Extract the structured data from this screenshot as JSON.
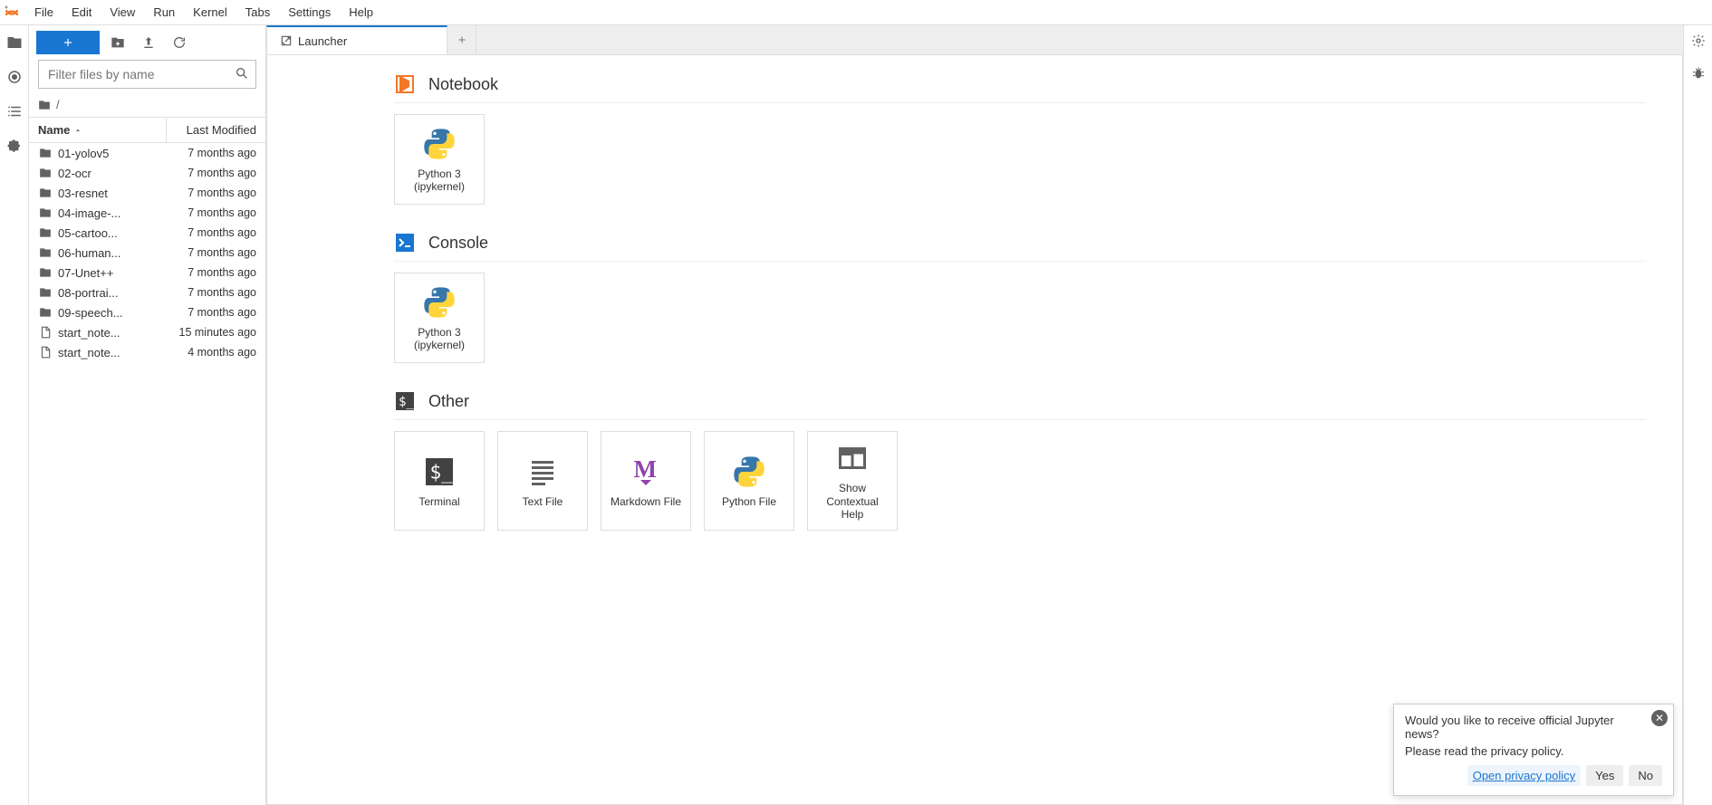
{
  "menu": {
    "items": [
      "File",
      "Edit",
      "View",
      "Run",
      "Kernel",
      "Tabs",
      "Settings",
      "Help"
    ]
  },
  "filebrowser": {
    "filter_placeholder": "Filter files by name",
    "breadcrumb_root": "/",
    "columns": {
      "name": "Name",
      "modified": "Last Modified"
    },
    "files": [
      {
        "type": "folder",
        "name": "01-yolov5",
        "modified": "7 months ago"
      },
      {
        "type": "folder",
        "name": "02-ocr",
        "modified": "7 months ago"
      },
      {
        "type": "folder",
        "name": "03-resnet",
        "modified": "7 months ago"
      },
      {
        "type": "folder",
        "name": "04-image-...",
        "modified": "7 months ago"
      },
      {
        "type": "folder",
        "name": "05-cartoo...",
        "modified": "7 months ago"
      },
      {
        "type": "folder",
        "name": "06-human...",
        "modified": "7 months ago"
      },
      {
        "type": "folder",
        "name": "07-Unet++",
        "modified": "7 months ago"
      },
      {
        "type": "folder",
        "name": "08-portrai...",
        "modified": "7 months ago"
      },
      {
        "type": "folder",
        "name": "09-speech...",
        "modified": "7 months ago"
      },
      {
        "type": "file",
        "name": "start_note...",
        "modified": "15 minutes ago"
      },
      {
        "type": "file",
        "name": "start_note...",
        "modified": "4 months ago"
      }
    ]
  },
  "tab": {
    "title": "Launcher"
  },
  "launcher": {
    "sections": [
      {
        "id": "notebook",
        "title": "Notebook",
        "icon": "notebook-icon",
        "accent": "#f37726",
        "cards": [
          {
            "icon": "python-icon",
            "label": "Python 3\n(ipykernel)"
          }
        ]
      },
      {
        "id": "console",
        "title": "Console",
        "icon": "console-icon",
        "accent": "#1976d2",
        "cards": [
          {
            "icon": "python-icon",
            "label": "Python 3\n(ipykernel)"
          }
        ]
      },
      {
        "id": "other",
        "title": "Other",
        "icon": "terminal-icon",
        "accent": "#424242",
        "cards": [
          {
            "icon": "terminal-icon",
            "label": "Terminal"
          },
          {
            "icon": "textfile-icon",
            "label": "Text File"
          },
          {
            "icon": "markdown-icon",
            "label": "Markdown File"
          },
          {
            "icon": "python-icon",
            "label": "Python File"
          },
          {
            "icon": "help-icon",
            "label": "Show\nContextual\nHelp"
          }
        ]
      }
    ]
  },
  "toast": {
    "line1": "Would you like to receive official Jupyter news?",
    "line2": "Please read the privacy policy.",
    "link": "Open privacy policy",
    "yes": "Yes",
    "no": "No"
  }
}
